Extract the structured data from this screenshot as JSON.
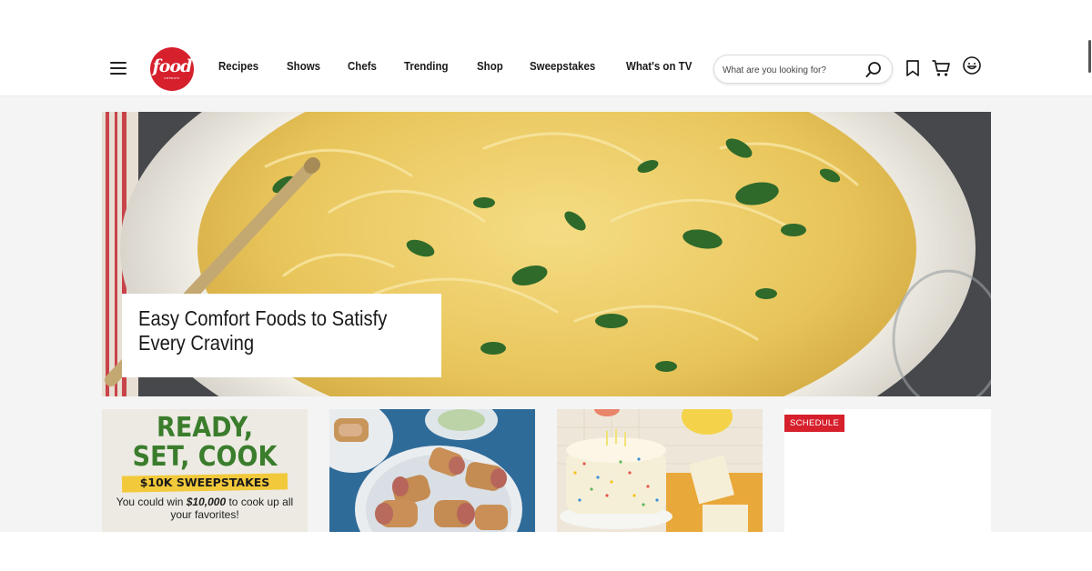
{
  "header": {
    "logo": {
      "word": "food",
      "sub": "network"
    },
    "nav": [
      "Recipes",
      "Shows",
      "Chefs",
      "Trending",
      "Shop",
      "Sweepstakes",
      "What's on TV"
    ],
    "search": {
      "placeholder": "What are you looking for?",
      "value": ""
    },
    "icons": [
      "menu-icon",
      "search-icon",
      "bookmark-icon",
      "cart-icon",
      "profile-icon"
    ]
  },
  "hero": {
    "title": "Easy Comfort Foods to Satisfy Every Craving",
    "image": "spaghetti-squash-carbonara-photo"
  },
  "cards": [
    {
      "kind": "sweepstakes",
      "line1": "READY,",
      "line2": "SET, COOK",
      "band": "$10K SWEEPSTAKES",
      "body_pre": "You could win ",
      "body_amount": "$10,000",
      "body_post": " to cook up all your favorites!"
    },
    {
      "kind": "photo",
      "image": "sausage-rolls-photo"
    },
    {
      "kind": "photo",
      "image": "birthday-cake-photo"
    },
    {
      "kind": "schedule",
      "badge": "SCHEDULE"
    }
  ],
  "colors": {
    "brand_red": "#d6202c",
    "sweepstakes_green": "#3a7d2c",
    "sweepstakes_yellow": "#f2c93a",
    "text_dark": "#1a1a1a"
  }
}
